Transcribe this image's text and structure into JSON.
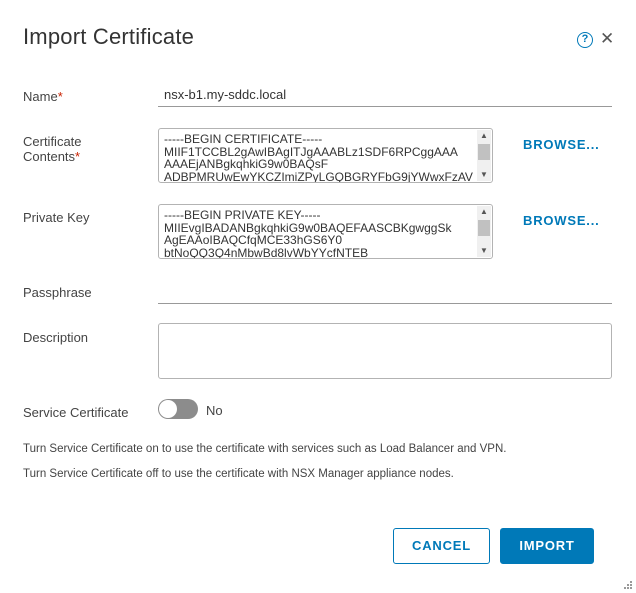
{
  "dialog": {
    "title": "Import Certificate",
    "help_icon": "help-circle-icon",
    "close_icon": "close-icon",
    "help_glyph": "?",
    "close_glyph": "✕"
  },
  "form": {
    "name": {
      "label": "Name",
      "required_mark": "*",
      "value": "nsx-b1.my-sddc.local"
    },
    "certificate_contents": {
      "label_line1": "Certificate",
      "label_line2": "Contents",
      "required_mark": "*",
      "value": "-----BEGIN CERTIFICATE-----\nMIIF1TCCBL2gAwIBAgITJgAAABLz1SDF6RPCggAAA\nAAAEjANBgkqhkiG9w0BAQsF\nADBPMRUwEwYKCZImiZPyLGQBGRYFbG9jYWwxFzAV",
      "browse_label": "BROWSE..."
    },
    "private_key": {
      "label": "Private Key",
      "value": "-----BEGIN PRIVATE KEY-----\nMIIEvgIBADANBgkqhkiG9w0BAQEFAASCBKgwggSk\nAgEAAoIBAQCfqMCE33hGS6Y0\nbtNoQQ3Q4nMbwBd8lvWbYYcfNTEB",
      "browse_label": "BROWSE..."
    },
    "passphrase": {
      "label": "Passphrase",
      "value": ""
    },
    "description": {
      "label": "Description",
      "value": ""
    },
    "service_certificate": {
      "label": "Service Certificate",
      "state_text": "No",
      "enabled": false
    }
  },
  "info": {
    "line1": "Turn Service Certificate on to use the certificate with services such as Load Balancer and VPN.",
    "line2": "Turn Service Certificate off to use the certificate with NSX Manager appliance nodes."
  },
  "buttons": {
    "cancel": "CANCEL",
    "import": "IMPORT"
  },
  "colors": {
    "accent": "#0079b8",
    "required": "#c92100",
    "toggle_off": "#8c8c8c"
  }
}
